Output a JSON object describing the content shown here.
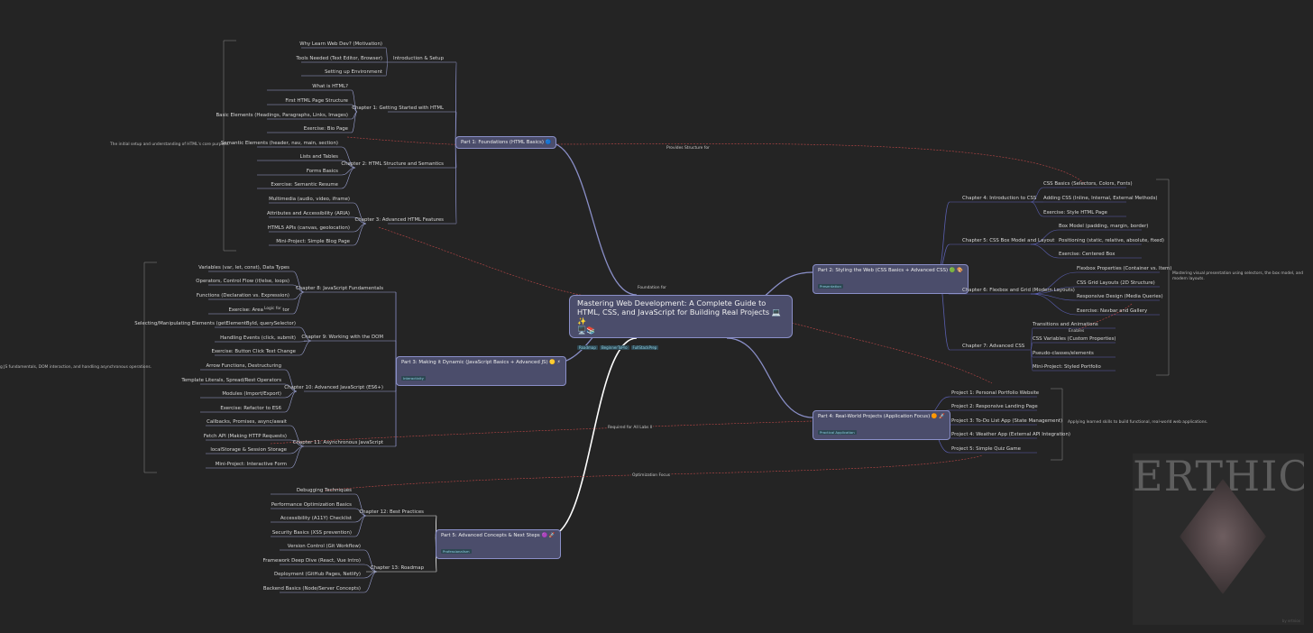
{
  "root": {
    "title": "Mastering Web Development: A Complete Guide to HTML, CSS, and JavaScript for Building Real Projects 💻✨",
    "emoji": "🖥️📚",
    "tags": [
      "Roadmap",
      "BeginnerToPro",
      "FullStackPrep"
    ]
  },
  "parts": [
    {
      "title": "Part 1: Foundations (HTML Basics) 🔵",
      "tag": ""
    },
    {
      "title": "Part 2: Styling the Web (CSS Basics + Advanced CSS) 🟢 🎨",
      "tag": "Presentation"
    },
    {
      "title": "Part 3: Making it Dynamic (JavaScript Basics + Advanced JS) 🟡 ⚡",
      "tag": "Interactivity"
    },
    {
      "title": "Part 4: Real-World Projects (Application Focus) 🟠 🚀",
      "tag": "Practical Application"
    },
    {
      "title": "Part 5: Advanced Concepts & Next Steps 🟣 🚀",
      "tag": "Professionalism"
    }
  ],
  "chapters": {
    "intro_setup": "Introduction & Setup",
    "ch1": "Chapter 1: Getting Started with HTML",
    "ch2": "Chapter 2: HTML Structure and Semantics",
    "ch3": "Chapter 3: Advanced HTML Features",
    "ch4": "Chapter 4: Introduction to CSS",
    "ch5": "Chapter 5: CSS Box Model and Layout",
    "ch6": "Chapter 6: Flexbox and Grid (Modern Layouts)",
    "ch7": "Chapter 7: Advanced CSS",
    "ch8": "Chapter 8: JavaScript Fundamentals",
    "ch9": "Chapter 9: Working with the DOM",
    "ch10": "Chapter 10: Advanced JavaScript (ES6+)",
    "ch11": "Chapter 11: Asynchronous JavaScript",
    "ch12": "Chapter 12: Best Practices",
    "ch13": "Chapter 13: Roadmap"
  },
  "leaves": {
    "intro": [
      "Why Learn Web Dev? (Motivation)",
      "Tools Needed (Text Editor, Browser)",
      "Setting up Environment"
    ],
    "ch1": [
      "What is HTML?",
      "First HTML Page Structure",
      "Basic Elements (Headings, Paragraphs, Links, Images)",
      "Exercise: Bio Page"
    ],
    "ch2": [
      "Semantic Elements (header, nav, main, section)",
      "Lists and Tables",
      "Forms Basics",
      "Exercise: Semantic Resume"
    ],
    "ch3": [
      "Multimedia (audio, video, iframe)",
      "Attributes and Accessibility (ARIA)",
      "HTML5 APIs (canvas, geolocation)",
      "Mini-Project: Simple Blog Page"
    ],
    "ch4": [
      "CSS Basics (Selectors, Colors, Fonts)",
      "Adding CSS (Inline, Internal, External Methods)",
      "Exercise: Style HTML Page"
    ],
    "ch5": [
      "Box Model (padding, margin, border)",
      "Positioning (static, relative, absolute, fixed)",
      "Exercise: Centered Box"
    ],
    "ch6": [
      "Flexbox Properties (Container vs. Item)",
      "CSS Grid Layouts (2D Structure)",
      "Responsive Design (Media Queries)",
      "Exercise: Navbar and Gallery"
    ],
    "ch7": [
      "Transitions and Animations",
      "CSS Variables (Custom Properties)",
      "Pseudo-classes/elements",
      "Mini-Project: Styled Portfolio"
    ],
    "ch8": [
      "Variables (var, let, const), Data Types",
      "Operators, Control Flow (if/else, loops)",
      "Functions (Declaration vs. Expression)",
      "Exercise: Area Calculator"
    ],
    "ch9": [
      "Selecting/Manipulating Elements (getElementById, querySelector)",
      "Handling Events (click, submit)",
      "Exercise: Button Click Text Change"
    ],
    "ch10": [
      "Arrow Functions, Destructuring",
      "Template Literals, Spread/Rest Operators",
      "Modules (Import/Export)",
      "Exercise: Refactor to ES6"
    ],
    "ch11": [
      "Callbacks, Promises, async/await",
      "Fetch API (Making HTTP Requests)",
      "localStorage & Session Storage",
      "Mini-Project: Interactive Form"
    ],
    "projects": [
      "Project 1: Personal Portfolio Website",
      "Project 2: Responsive Landing Page",
      "Project 3: To-Do List App (State Management)",
      "Project 4: Weather App (External API Integration)",
      "Project 5: Simple Quiz Game"
    ],
    "ch12": [
      "Debugging Techniques",
      "Performance Optimization Basics",
      "Accessibility (A11Y) Checklist",
      "Security Basics (XSS prevention)"
    ],
    "ch13": [
      "Version Control (Git Workflow)",
      "Framework Deep Dive (React, Vue Intro)",
      "Deployment (GitHub Pages, Netlify)",
      "Backend Basics (Node/Server Concepts)"
    ]
  },
  "summaries": {
    "part1": "The initial setup and understanding of HTML's core purpose.",
    "part2": "Mastering visual presentation using selectors, the box model, and modern layouts.",
    "part3": "g JS fundamentals, DOM interaction, and handling asynchronous operations.",
    "part4": "Applying learned skills to build functional, real-world web applications."
  },
  "relations": {
    "provides_structure": "Provides Structure for",
    "foundation_for": "Foundation for",
    "logic_for": "Logic for",
    "enables": "Enables",
    "required_for": "Required for All Labs ll",
    "optimization_focus": "Optimization Focus"
  },
  "watermark": {
    "text": "ERTHIOX",
    "credit": "by ertniox"
  },
  "colors": {
    "background": "#242424",
    "node_fill": "#4b4d6b",
    "node_border": "#8a8fc8",
    "branch_blue": "#8a8fc8",
    "branch_white": "#ffffff",
    "relation_red": "#c04848",
    "tag_text": "#8fd3e6"
  }
}
